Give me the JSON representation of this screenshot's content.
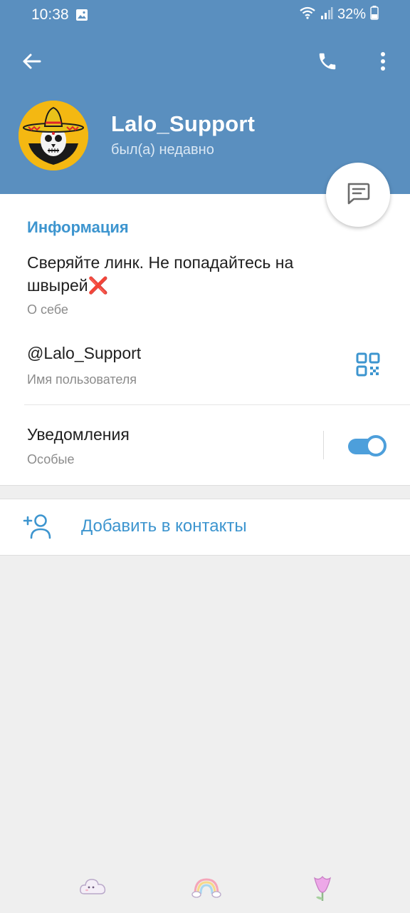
{
  "status_bar": {
    "time": "10:38",
    "battery": "32%",
    "icons": [
      "gallery-icon",
      "wifi-icon",
      "signal-icon",
      "battery-icon"
    ]
  },
  "toolbar": {
    "back_icon": "arrow-left-icon",
    "call_icon": "phone-icon",
    "menu_icon": "more-vertical-icon"
  },
  "profile": {
    "name": "Lalo_Support",
    "status": "был(а) недавно",
    "avatar_icon": "sombrero-skull-avatar"
  },
  "fab": {
    "icon": "message-icon"
  },
  "info": {
    "section_title": "Информация",
    "bio": "Сверяйте линк. Не попадайтесь на швырей",
    "bio_emoji": "❌",
    "bio_label": "О себе",
    "username": "@Lalo_Support",
    "username_label": "Имя пользователя",
    "qr_icon": "qr-code-icon",
    "notifications": "Уведомления",
    "notifications_label": "Особые",
    "notifications_enabled": true
  },
  "actions": {
    "add_contact": "Добавить в контакты",
    "add_contact_icon": "add-user-icon"
  },
  "nav_bar": {
    "items": [
      "cloud-sticker-icon",
      "rainbow-sticker-icon",
      "tulip-sticker-icon"
    ]
  },
  "colors": {
    "header": "#5a8fbf",
    "accent": "#3d95cf",
    "toggle": "#4d9fdb",
    "background": "#efefef"
  }
}
